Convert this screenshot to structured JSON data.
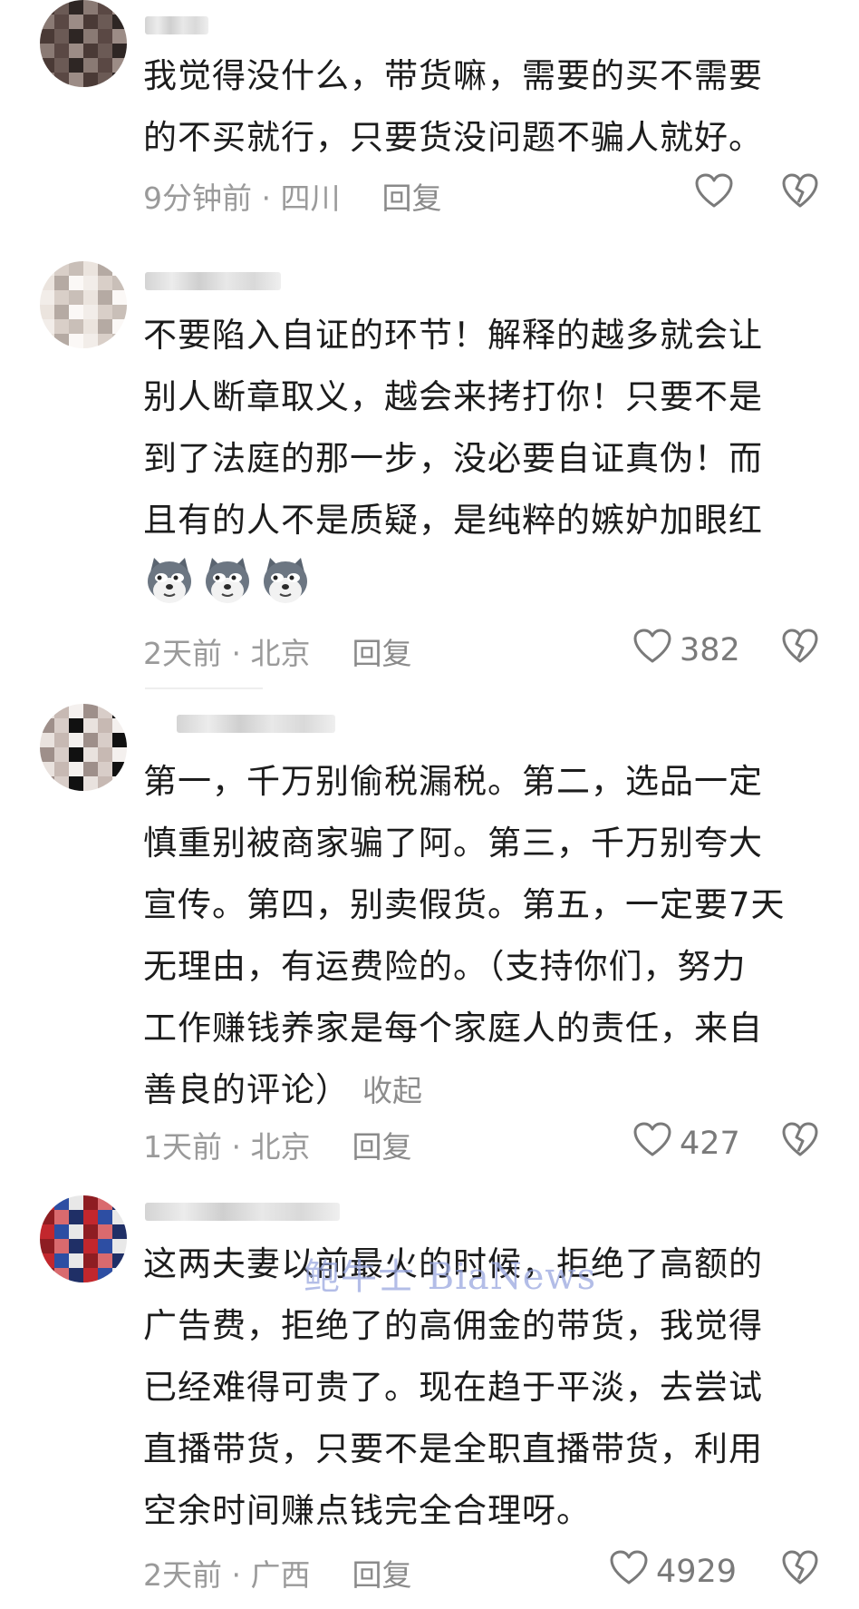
{
  "comments": [
    {
      "lines": [
        "我觉得没什么，带货嘛，需要的买不需要",
        "的不买就行，只要货没问题不骗人就好。"
      ],
      "time_location": "9分钟前 · 四川",
      "reply_label": "回复",
      "likes": ""
    },
    {
      "lines": [
        "不要陷入自证的环节！解释的越多就会让",
        "别人断章取义，越会来拷打你！只要不是",
        "到了法庭的那一步，没必要自证真伪！而",
        "且有的人不是质疑，是纯粹的嫉妒加眼红"
      ],
      "emojis": [
        "doge-emoji",
        "doge-emoji",
        "doge-emoji"
      ],
      "time_location": "2天前 · 北京",
      "reply_label": "回复",
      "likes": "382"
    },
    {
      "lines": [
        "第一，千万别偷税漏税。第二，选品一定",
        "慎重别被商家骗了阿。第三，千万别夸大",
        "宣传。第四，别卖假货。第五，一定要7天",
        "无理由，有运费险的。（支持你们，努力",
        "工作赚钱养家是每个家庭人的责任，来自",
        "善良的评论）"
      ],
      "collapse_label": "收起",
      "time_location": "1天前 · 北京",
      "reply_label": "回复",
      "likes": "427"
    },
    {
      "lines": [
        "这两夫妻以前最火的时候，拒绝了高额的",
        "广告费，拒绝了的高佣金的带货，我觉得",
        "已经难得可贵了。现在趋于平淡，去尝试",
        "直播带货，只要不是全职直播带货，利用",
        "空余时间赚点钱完全合理呀。"
      ],
      "time_location": "2天前 · 广西",
      "reply_label": "回复",
      "likes": "4929"
    }
  ],
  "icons": {
    "like": "heart-icon",
    "dislike": "broken-heart-icon"
  },
  "colors": {
    "text": "#1c1c1c",
    "meta": "#9a9a9a",
    "icon": "#7a7a7a"
  },
  "watermark": "鲍牛士 BiaNews"
}
